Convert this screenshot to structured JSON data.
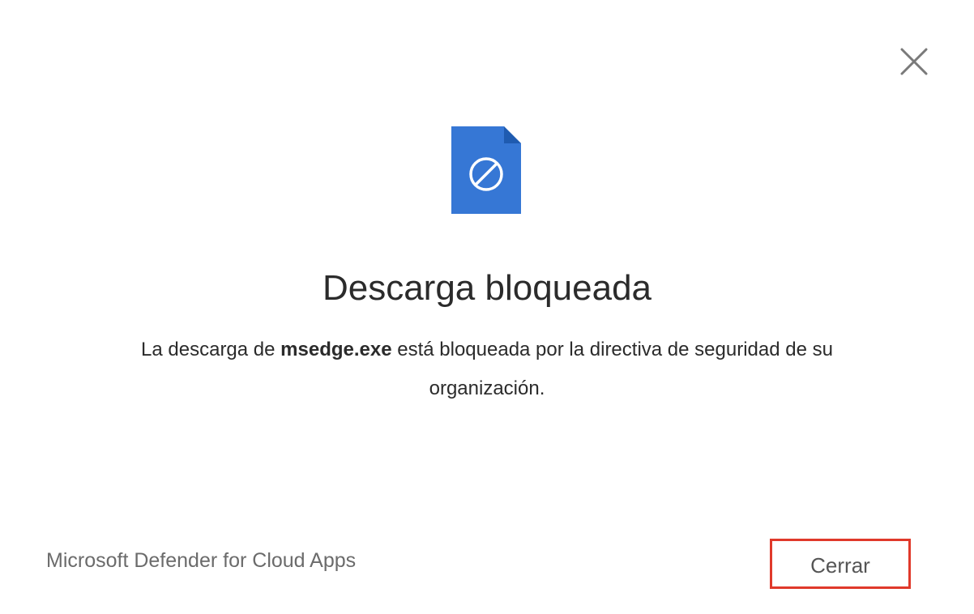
{
  "dialog": {
    "title": "Descarga bloqueada",
    "message": {
      "before": "La descarga de ",
      "filename": "msedge.exe",
      "after": " está bloqueada por la directiva de seguridad de su organización."
    },
    "brand": "Microsoft Defender for Cloud Apps",
    "close_button_label": "Cerrar",
    "close_icon": "close-icon",
    "file_icon": "blocked-file-icon"
  },
  "colors": {
    "file_icon_fill": "#3677d5",
    "file_icon_fold": "#1f5bb0",
    "button_highlight": "#e0392b"
  }
}
